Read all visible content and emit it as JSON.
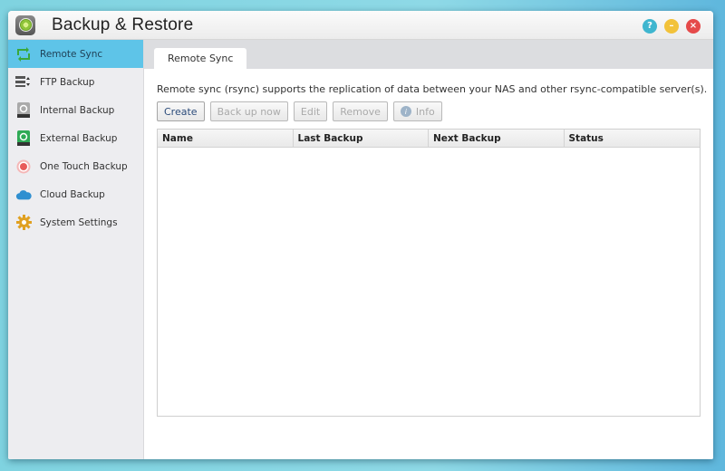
{
  "window": {
    "title": "Backup & Restore",
    "controls": {
      "help": "?",
      "minimize": "–",
      "close": "×"
    }
  },
  "sidebar": {
    "items": [
      {
        "label": "Remote Sync",
        "icon": "remote-sync-icon",
        "active": true
      },
      {
        "label": "FTP Backup",
        "icon": "ftp-backup-icon"
      },
      {
        "label": "Internal Backup",
        "icon": "internal-backup-icon"
      },
      {
        "label": "External Backup",
        "icon": "external-backup-icon"
      },
      {
        "label": "One Touch Backup",
        "icon": "one-touch-backup-icon"
      },
      {
        "label": "Cloud Backup",
        "icon": "cloud-backup-icon"
      },
      {
        "label": "System Settings",
        "icon": "gear-icon"
      }
    ]
  },
  "main": {
    "tab": "Remote Sync",
    "description": "Remote sync (rsync) supports the replication of data between your NAS and other rsync-compatible server(s).",
    "toolbar": {
      "create": "Create",
      "backup_now": "Back up now",
      "edit": "Edit",
      "remove": "Remove",
      "info": "Info"
    },
    "table": {
      "columns": [
        "Name",
        "Last Backup",
        "Next Backup",
        "Status"
      ],
      "rows": []
    }
  }
}
